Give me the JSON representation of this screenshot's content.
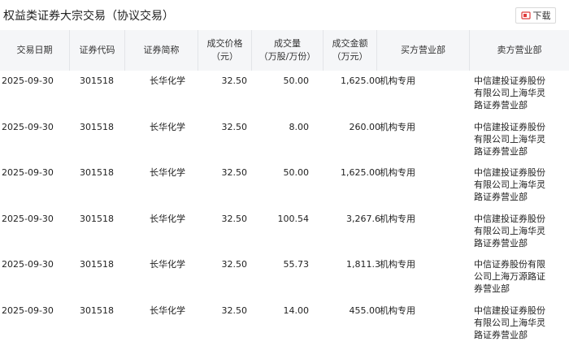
{
  "title": "权益类证券大宗交易（协议交易）",
  "download_label": "下载",
  "columns": {
    "date": [
      "交易日期"
    ],
    "code": [
      "证券代码"
    ],
    "name": [
      "证券简称"
    ],
    "price": [
      "成交价格",
      "（元）"
    ],
    "volume": [
      "成交量",
      "（万股/万份）"
    ],
    "amount": [
      "成交金额",
      "（万元）"
    ],
    "buyer": [
      "买方营业部"
    ],
    "seller": [
      "卖方营业部"
    ]
  },
  "rows": [
    {
      "date": "2025-09-30",
      "code": "301518",
      "name": "长华化学",
      "price": "32.50",
      "volume": "50.00",
      "amount": "1,625.00",
      "buyer": "机构专用",
      "seller": "中信建投证券股份有限公司上海华灵路证券营业部"
    },
    {
      "date": "2025-09-30",
      "code": "301518",
      "name": "长华化学",
      "price": "32.50",
      "volume": "8.00",
      "amount": "260.00",
      "buyer": "机构专用",
      "seller": "中信建投证券股份有限公司上海华灵路证券营业部"
    },
    {
      "date": "2025-09-30",
      "code": "301518",
      "name": "长华化学",
      "price": "32.50",
      "volume": "50.00",
      "amount": "1,625.00",
      "buyer": "机构专用",
      "seller": "中信建投证券股份有限公司上海华灵路证券营业部"
    },
    {
      "date": "2025-09-30",
      "code": "301518",
      "name": "长华化学",
      "price": "32.50",
      "volume": "100.54",
      "amount": "3,267.6",
      "buyer": "机构专用",
      "seller": "中信建投证券股份有限公司上海华灵路证券营业部"
    },
    {
      "date": "2025-09-30",
      "code": "301518",
      "name": "长华化学",
      "price": "32.50",
      "volume": "55.73",
      "amount": "1,811.3",
      "buyer": "机构专用",
      "seller": "中信证券股份有限公司上海万源路证券营业部"
    },
    {
      "date": "2025-09-30",
      "code": "301518",
      "name": "长华化学",
      "price": "32.50",
      "volume": "14.00",
      "amount": "455.00",
      "buyer": "机构专用",
      "seller": "中信建投证券股份有限公司上海华灵路证券营业部"
    }
  ],
  "colors": {
    "header_bg": "#f5f6f8",
    "border": "#e3e5e8",
    "accent": "#e03c3c"
  },
  "icons": {
    "download": "download-icon"
  }
}
